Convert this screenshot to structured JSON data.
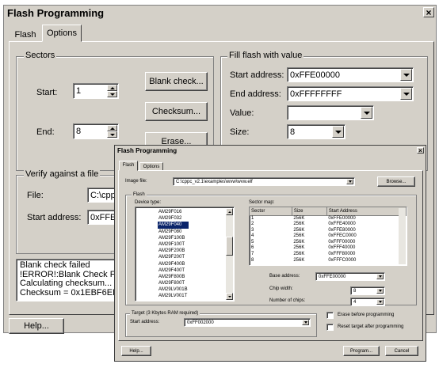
{
  "back": {
    "title": "Flash Programming",
    "close": "×",
    "tabs": {
      "flash": "Flash",
      "options": "Options"
    },
    "sectors": {
      "group": "Sectors",
      "start_label": "Start:",
      "start_value": "1",
      "end_label": "End:",
      "end_value": "8",
      "blank_check": "Blank check...",
      "checksum": "Checksum...",
      "erase": "Erase..."
    },
    "fill": {
      "group": "Fill flash with value",
      "start_label": "Start address:",
      "start_value": "0xFFE00000",
      "end_label": "End address:",
      "end_value": "0xFFFFFFFF",
      "value_label": "Value:",
      "value_value": "",
      "size_label": "Size:",
      "size_value": "8"
    },
    "verify": {
      "group": "Verify against a file",
      "file_label": "File:",
      "file_value": "C:\\cppc",
      "start_label": "Start address:",
      "start_value": "0xFFE0"
    },
    "log": [
      "Blank check failed",
      "!ERROR!:Blank Check Fai",
      "Calculating checksum...",
      "Checksum = 0x1EBF6EB4"
    ],
    "help": "Help..."
  },
  "front": {
    "title": "Flash Programming",
    "close": "×",
    "tabs": {
      "flash": "Flash",
      "options": "Options"
    },
    "image_label": "Image file:",
    "image_value": "C:\\cppc_v2.1\\examples\\wvw\\wvw.elf",
    "browse": "Browse...",
    "flash_group": "Flash",
    "device_type_label": "Device type:",
    "devices": [
      "AM29F016",
      "AM29F032",
      "AM29F040",
      "AM29F080",
      "AM29F100B",
      "AM29F100T",
      "AM29F200B",
      "AM29F200T",
      "AM29F400B",
      "AM29F400T",
      "AM29F800B",
      "AM29F800T",
      "AM29LV001B",
      "AM29LV001T"
    ],
    "selected_device": "AM29F040",
    "sector_map_label": "Sector map:",
    "sector_headers": [
      "Sector",
      "Size",
      "Start Address"
    ],
    "sectors": [
      [
        "1",
        "256K",
        "0xFFE00000"
      ],
      [
        "2",
        "256K",
        "0xFFE40000"
      ],
      [
        "3",
        "256K",
        "0xFFE80000"
      ],
      [
        "4",
        "256K",
        "0xFFEC0000"
      ],
      [
        "5",
        "256K",
        "0xFFF00000"
      ],
      [
        "6",
        "256K",
        "0xFFF40000"
      ],
      [
        "7",
        "256K",
        "0xFFF80000"
      ],
      [
        "8",
        "256K",
        "0xFFFC0000"
      ]
    ],
    "base_address_label": "Base address:",
    "base_address_value": "0xFFE00000",
    "chip_width_label": "Chip width:",
    "chip_width_value": "8",
    "num_chips_label": "Number of chips:",
    "num_chips_value": "4",
    "target_group": "Target (3 Kbytes RAM required)",
    "target_start_label": "Start address:",
    "target_start_value": "0xFF002000",
    "erase_before": "Erase before programming",
    "reset_target": "Reset target after programming",
    "help": "Help...",
    "program": "Program...",
    "cancel": "Cancel"
  }
}
